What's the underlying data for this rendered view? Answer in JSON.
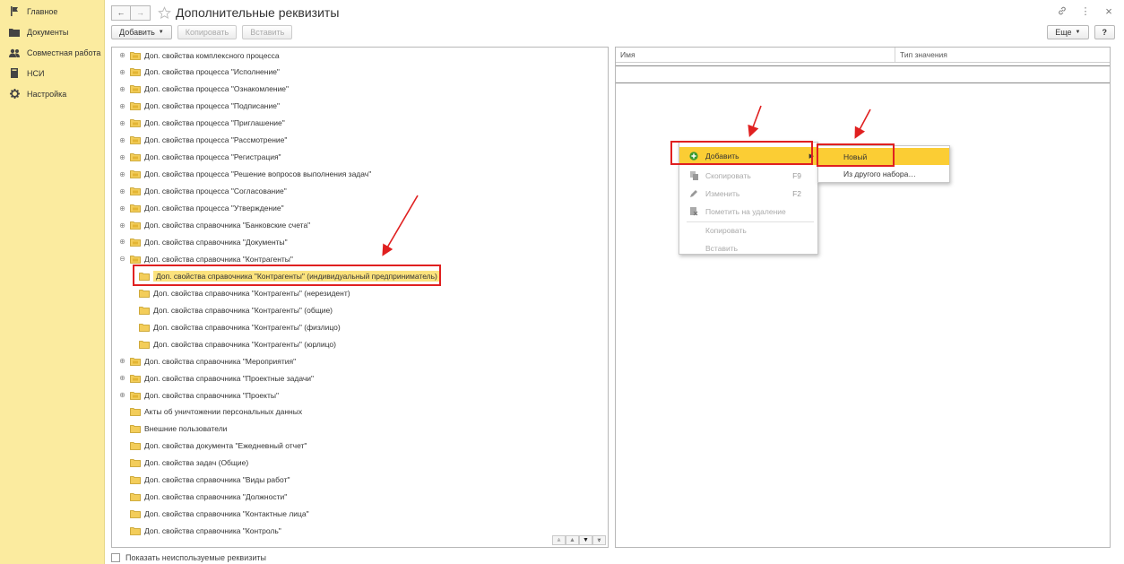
{
  "sidebar": {
    "items": [
      {
        "label": "Главное",
        "icon": "flag-icon"
      },
      {
        "label": "Документы",
        "icon": "folder-icon"
      },
      {
        "label": "Совместная работа",
        "icon": "users-icon"
      },
      {
        "label": "НСИ",
        "icon": "book-icon"
      },
      {
        "label": "Настройка",
        "icon": "gear-icon"
      }
    ]
  },
  "header": {
    "back": "←",
    "forward": "→",
    "title": "Дополнительные реквизиты",
    "link_icon": "⚲",
    "menu_icon": "⋮",
    "close_icon": "×"
  },
  "toolbar": {
    "add_label": "Добавить",
    "copy_label": "Копировать",
    "paste_label": "Вставить",
    "more_label": "Еще",
    "help_label": "?"
  },
  "tree": {
    "items": [
      {
        "label": "Доп. свойства комплексного процесса",
        "expander": "plus",
        "level": 0
      },
      {
        "label": "Доп. свойства процесса \"Исполнение\"",
        "expander": "plus",
        "level": 0
      },
      {
        "label": "Доп. свойства процесса \"Ознакомление\"",
        "expander": "plus",
        "level": 0
      },
      {
        "label": "Доп. свойства процесса \"Подписание\"",
        "expander": "plus",
        "level": 0
      },
      {
        "label": "Доп. свойства процесса \"Приглашение\"",
        "expander": "plus",
        "level": 0
      },
      {
        "label": "Доп. свойства процесса \"Рассмотрение\"",
        "expander": "plus",
        "level": 0
      },
      {
        "label": "Доп. свойства процесса \"Регистрация\"",
        "expander": "plus",
        "level": 0
      },
      {
        "label": "Доп. свойства процесса \"Решение вопросов выполнения задач\"",
        "expander": "plus",
        "level": 0
      },
      {
        "label": "Доп. свойства процесса \"Согласование\"",
        "expander": "plus",
        "level": 0
      },
      {
        "label": "Доп. свойства процесса \"Утверждение\"",
        "expander": "plus",
        "level": 0
      },
      {
        "label": "Доп. свойства справочника \"Банковские счета\"",
        "expander": "plus",
        "level": 0
      },
      {
        "label": "Доп. свойства справочника \"Документы\"",
        "expander": "plus",
        "level": 0
      },
      {
        "label": "Доп. свойства справочника \"Контрагенты\"",
        "expander": "minus",
        "level": 0
      },
      {
        "label": "Доп. свойства справочника \"Контрагенты\" (индивидуальный предприниматель)",
        "expander": "none",
        "level": 1,
        "selected": true
      },
      {
        "label": "Доп. свойства справочника \"Контрагенты\" (нерезидент)",
        "expander": "none",
        "level": 1
      },
      {
        "label": "Доп. свойства справочника \"Контрагенты\" (общие)",
        "expander": "none",
        "level": 1
      },
      {
        "label": "Доп. свойства справочника \"Контрагенты\" (физлицо)",
        "expander": "none",
        "level": 1
      },
      {
        "label": "Доп. свойства справочника \"Контрагенты\" (юрлицо)",
        "expander": "none",
        "level": 1
      },
      {
        "label": "Доп. свойства справочника \"Мероприятия\"",
        "expander": "plus",
        "level": 0
      },
      {
        "label": "Доп. свойства справочника \"Проектные задачи\"",
        "expander": "plus",
        "level": 0
      },
      {
        "label": "Доп. свойства справочника \"Проекты\"",
        "expander": "plus",
        "level": 0
      },
      {
        "label": "Акты об уничтожении персональных данных",
        "expander": "none",
        "level": 0
      },
      {
        "label": "Внешние пользователи",
        "expander": "none",
        "level": 0
      },
      {
        "label": "Доп. свойства документа \"Ежедневный отчет\"",
        "expander": "none",
        "level": 0
      },
      {
        "label": "Доп. свойства задач (Общие)",
        "expander": "none",
        "level": 0
      },
      {
        "label": "Доп. свойства справочника \"Виды работ\"",
        "expander": "none",
        "level": 0
      },
      {
        "label": "Доп. свойства справочника \"Должности\"",
        "expander": "none",
        "level": 0
      },
      {
        "label": "Доп. свойства справочника \"Контактные лица\"",
        "expander": "none",
        "level": 0
      },
      {
        "label": "Доп. свойства справочника \"Контроль\"",
        "expander": "none",
        "level": 0
      }
    ]
  },
  "grid": {
    "columns": [
      "Имя",
      "Тип значения"
    ]
  },
  "context_menu": {
    "items": [
      {
        "label": "Добавить",
        "key": "",
        "active": true,
        "icon": "plus-circle-icon",
        "submenu": true
      },
      {
        "label": "Скопировать",
        "key": "F9",
        "icon": "copy-icon"
      },
      {
        "label": "Изменить",
        "key": "F2",
        "icon": "pencil-icon"
      },
      {
        "label": "Пометить на удаление",
        "key": "",
        "icon": "delete-mark-icon"
      },
      {
        "label": "Копировать",
        "key": "",
        "icon": ""
      },
      {
        "label": "Вставить",
        "key": "",
        "icon": ""
      }
    ]
  },
  "submenu": {
    "items": [
      {
        "label": "Новый",
        "active": true
      },
      {
        "label": "Из другого набора…"
      }
    ]
  },
  "footer": {
    "show_unused_label": "Показать неиспользуемые реквизиты"
  },
  "colors": {
    "sidebar_bg": "#fbeb9f",
    "accent": "#fbcd34",
    "highlight_red": "#e02020",
    "selected_row": "#fbe27d"
  }
}
